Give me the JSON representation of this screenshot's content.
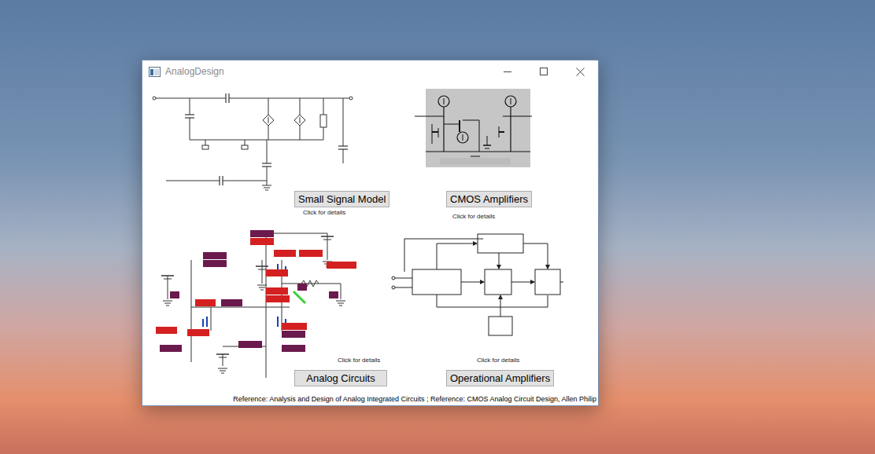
{
  "window": {
    "title": "AnalogDesign"
  },
  "panels": [
    {
      "label": "Small Signal Model",
      "hint": "Click for details",
      "kind": "small-signal"
    },
    {
      "label": "CMOS Amplifiers",
      "hint": "Click for details",
      "kind": "cmos"
    },
    {
      "label": "Analog Circuits",
      "hint": "Click for details",
      "kind": "analog"
    },
    {
      "label": "Operational Amplifiers",
      "hint": "Click for details",
      "kind": "opamp"
    }
  ],
  "footer": "Reference: Analysis and Design of Analog Integrated Circuits ;  Reference: CMOS Analog Circuit Design, Allen Philip"
}
